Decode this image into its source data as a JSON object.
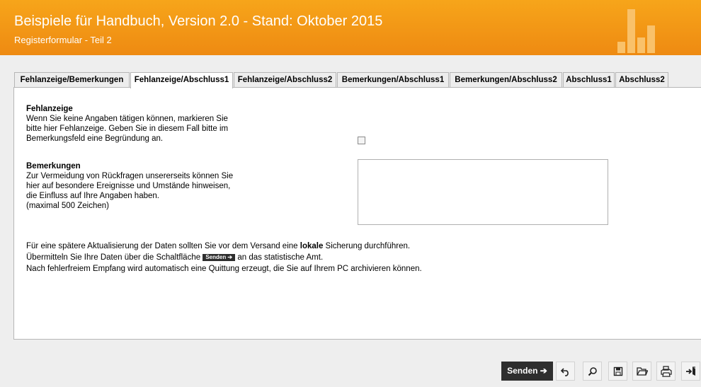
{
  "header": {
    "title": "Beispiele für Handbuch, Version 2.0 - Stand: Oktober 2015",
    "subtitle": "Registerformular - Teil 2"
  },
  "tabs": [
    {
      "label": "Fehlanzeige/Bemerkungen",
      "active": false
    },
    {
      "label": "Fehlanzeige/Abschluss1",
      "active": true
    },
    {
      "label": "Fehlanzeige/Abschluss2",
      "active": false
    },
    {
      "label": "Bemerkungen/Abschluss1",
      "active": false
    },
    {
      "label": "Bemerkungen/Abschluss2",
      "active": false
    },
    {
      "label": "Abschluss1",
      "active": false
    },
    {
      "label": "Abschluss2",
      "active": false
    }
  ],
  "form": {
    "fehlanzeige": {
      "heading": "Fehlanzeige",
      "lines": [
        "Wenn Sie keine Angaben tätigen können, markieren Sie",
        "bitte hier Fehlanzeige. Geben Sie in diesem Fall bitte im",
        "Bemerkungsfeld eine Begründung an."
      ],
      "checked": false
    },
    "bemerkungen": {
      "heading": "Bemerkungen",
      "lines": [
        "Zur Vermeidung von Rückfragen unsererseits können Sie",
        "hier auf besondere Ereignisse und Umstände hinweisen,",
        "die Einfluss auf Ihre Angaben haben.",
        "(maximal 500 Zeichen)"
      ],
      "value": ""
    }
  },
  "info": {
    "line1_pre": "Für eine spätere Aktualisierung der Daten sollten Sie vor dem Versand eine ",
    "line1_bold": "lokale",
    "line1_post": " Sicherung durchführen.",
    "line2_pre": "Übermitteln Sie Ihre Daten über die Schaltfläche ",
    "line2_button": "Senden ➔",
    "line2_post": " an das statistische Amt.",
    "line3": "Nach fehlerfreiem Empfang wird automatisch eine Quittung erzeugt, die Sie auf Ihrem PC archivieren können."
  },
  "toolbar": {
    "send_label": "Senden ➔",
    "icons": [
      "undo-icon",
      "search-icon",
      "save-icon",
      "open-folder-icon",
      "print-icon",
      "exit-icon"
    ]
  },
  "colors": {
    "header": "#ee8a12",
    "dark_button": "#2e2e2e"
  }
}
